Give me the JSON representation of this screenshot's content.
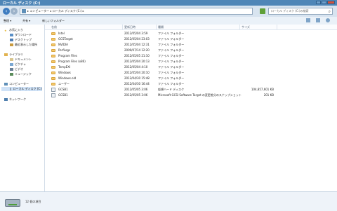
{
  "window": {
    "title": "ローカル ディスク (C:)"
  },
  "address": {
    "path": "▸ コンピューター ▸ ローカル ディスク (C:) ▸",
    "search_placeholder": "ローカル ディスク (C:)の検索"
  },
  "toolbar": {
    "organize": "整理 ▾",
    "share": "共有 ▾",
    "new_folder": "新しいフォルダー"
  },
  "nav": {
    "favorites": "お気に入り",
    "downloads": "ダウンロード",
    "desktop": "デスクトップ",
    "recent": "最近表示した場所",
    "libraries": "ライブラリ",
    "documents": "ドキュメント",
    "pictures": "ピクチャ",
    "videos": "ビデオ",
    "music": "ミュージック",
    "computer": "コンピューター",
    "local_disk": "ローカル ディスク (C:)",
    "network": "ネットワーク"
  },
  "columns": {
    "name": "名前",
    "date": "更新日時",
    "type": "種類",
    "size": "サイズ"
  },
  "rows": [
    {
      "name": "Intel",
      "date": "2012/05/04 3:59",
      "type": "ファイル フォルダー",
      "size": ""
    },
    {
      "name": "GCSTarget",
      "date": "2012/05/04 23:03",
      "type": "ファイル フォルダー",
      "size": ""
    },
    {
      "name": "NVIDIA",
      "date": "2012/05/04 12:31",
      "type": "ファイル フォルダー",
      "size": ""
    },
    {
      "name": "PerfLogs",
      "date": "2009/07/14 12:20",
      "type": "ファイル フォルダー",
      "size": ""
    },
    {
      "name": "Program Files",
      "date": "2012/05/05 21:10",
      "type": "ファイル フォルダー",
      "size": ""
    },
    {
      "name": "Program Files (x86)",
      "date": "2012/05/04 20:13",
      "type": "ファイル フォルダー",
      "size": ""
    },
    {
      "name": "TempEXI",
      "date": "2012/05/04 4:10",
      "type": "ファイル フォルダー",
      "size": ""
    },
    {
      "name": "Windows",
      "date": "2012/05/04 20:10",
      "type": "ファイル フォルダー",
      "size": ""
    },
    {
      "name": "Windows.old",
      "date": "2012/04/30 15:48",
      "type": "ファイル フォルダー",
      "size": ""
    },
    {
      "name": "ユーザー",
      "date": "2012/04/30 16:44",
      "type": "ファイル フォルダー",
      "size": ""
    },
    {
      "name": "GCSB1",
      "date": "2012/05/05 3:06",
      "type": "仮想ハード ディスク",
      "size": "104,857,601 KB"
    },
    {
      "name": "GCSB1",
      "date": "2012/05/05 3:06",
      "type": "Microsoft GCSI Software Target の変更差分のスナップショット",
      "size": "201 KB"
    }
  ],
  "status": {
    "count": "12 個の項目"
  },
  "colors": {
    "accent": "#4f86b7",
    "folder": "#f3c86a",
    "selected": "#cfe2f7"
  }
}
